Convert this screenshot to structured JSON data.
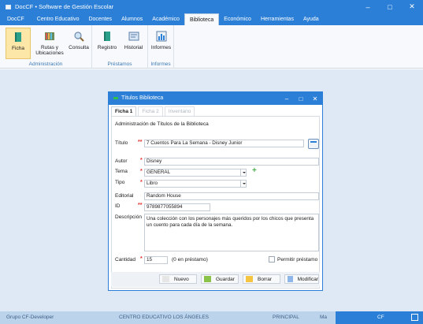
{
  "window": {
    "title": "DocCF • Software de Gestión Escolar"
  },
  "menu": [
    "DocCF",
    "Centro Educativo",
    "Docentes",
    "Alumnos",
    "Académico",
    "Biblioteca",
    "Económico",
    "Herramientas",
    "Ayuda"
  ],
  "active_menu": "Biblioteca",
  "ribbon": {
    "groups": [
      {
        "label": "Administración",
        "buttons": [
          {
            "label": "Ficha",
            "icon": "book-icon"
          },
          {
            "label": "Rutas y Ubicaciones",
            "icon": "shelf-icon"
          },
          {
            "label": "Consulta",
            "icon": "magnifier-icon"
          }
        ]
      },
      {
        "label": "Préstamos",
        "buttons": [
          {
            "label": "Registro",
            "icon": "book-icon"
          },
          {
            "label": "Historial",
            "icon": "history-icon"
          }
        ]
      },
      {
        "label": "Informes",
        "buttons": [
          {
            "label": "Informes",
            "icon": "report-icon"
          }
        ]
      }
    ]
  },
  "status": {
    "group": "Grupo CF-Developer",
    "school": "CENTRO EDUCATIVO LOS ÁNGELES",
    "level": "PRINCIPAL",
    "user": "Ma",
    "cf": "CF"
  },
  "dialog": {
    "title": "Títulos Biblioteca",
    "tabs": [
      "Ficha  1",
      "Ficha  2",
      "Inventario"
    ],
    "heading": "Administración de Títulos de la Biblioteca",
    "labels": {
      "titulo": "Título",
      "autor": "Autor",
      "tema": "Tema",
      "tipo": "Tipo",
      "editorial": "Editorial",
      "id": "ID",
      "descripcion": "Descripción",
      "cantidad": "Cantidad",
      "en_prestamo": "(0 en préstamo)",
      "permitir": "Permitir préstamo"
    },
    "values": {
      "titulo": "7 Cuentos Para La Semana - Disney Junior",
      "autor": "Disney",
      "tema": "GENERAL",
      "tipo": "Libro",
      "editorial": "Random House",
      "id": "9789877055894",
      "descripcion": "Una colección con los personajes más queridos por los chicos que presenta un cuento para cada día de la semana.",
      "cantidad": "15"
    },
    "permitir_checked": false,
    "buttons": {
      "nuevo": "Nuevo",
      "guardar": "Guardar",
      "borrar": "Borrar",
      "modificar": "Modificar"
    },
    "colors": {
      "nuevo": "#e6e6e6",
      "guardar": "#8bc34a",
      "borrar": "#f5c542",
      "modificar": "#8fb6e8"
    }
  }
}
